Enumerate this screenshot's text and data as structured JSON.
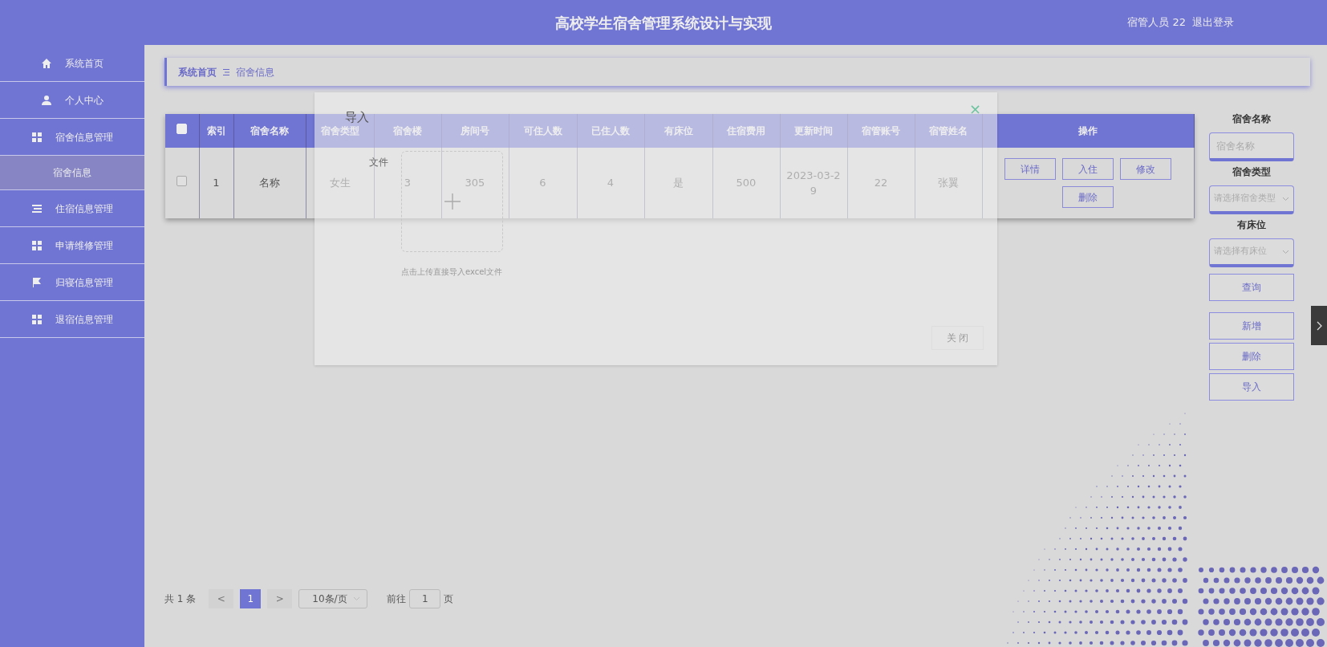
{
  "header": {
    "title": "高校学生宿舍管理系统设计与实现",
    "user": "宿管人员 22",
    "logout": "退出登录"
  },
  "sidebar": {
    "items": [
      {
        "label": "系统首页",
        "selected": false
      },
      {
        "label": "个人中心",
        "selected": false
      },
      {
        "label": "宿舍信息管理",
        "selected": false,
        "children": [
          {
            "label": "宿舍信息",
            "selected": true
          }
        ]
      },
      {
        "label": "住宿信息管理",
        "selected": false
      },
      {
        "label": "申请维修管理",
        "selected": false
      },
      {
        "label": "归寝信息管理",
        "selected": false
      },
      {
        "label": "退宿信息管理",
        "selected": false
      }
    ]
  },
  "breadcrumb": [
    "系统首页",
    "宿舍信息"
  ],
  "table": {
    "select_all": {
      "checked": false
    },
    "columns": [
      "索引",
      "宿舍名称",
      "宿舍类型",
      "宿舍楼",
      "房间号",
      "可住人数",
      "已住人数",
      "有床位",
      "住宿费用",
      "更新时间",
      "宿管账号",
      "宿管姓名",
      "操作"
    ],
    "rows": [
      {
        "checked": false,
        "cells": [
          "1",
          "名称",
          "女生",
          "3",
          "305",
          "6",
          "4",
          "是",
          "500",
          "2023-03-29",
          "22",
          "张翼"
        ],
        "actions": [
          "详情",
          "入住",
          "修改",
          "删除"
        ]
      }
    ]
  },
  "search": {
    "fields": [
      {
        "kind": "input",
        "label": "宿舍名称",
        "placeholder": "宿舍名称"
      },
      {
        "kind": "select",
        "label": "宿舍类型",
        "placeholder": "请选择宿舍类型"
      },
      {
        "kind": "select",
        "label": "有床位",
        "placeholder": "请选择有床位"
      }
    ],
    "query_button": "查询",
    "buttons": [
      "新增",
      "删除",
      "导入"
    ]
  },
  "pagination": {
    "total": "共 1 条",
    "prev": "<",
    "pages": [
      {
        "label": "1",
        "selected": true
      }
    ],
    "next": ">",
    "page_size": "10条/页",
    "goto_label": "前往",
    "goto_value": "1",
    "goto_suffix": "页"
  },
  "dialog": {
    "title": "导入",
    "close": "×",
    "field_label": "文件",
    "hint": "点击上传直接导入excel文件",
    "close_button": "关 闭"
  }
}
